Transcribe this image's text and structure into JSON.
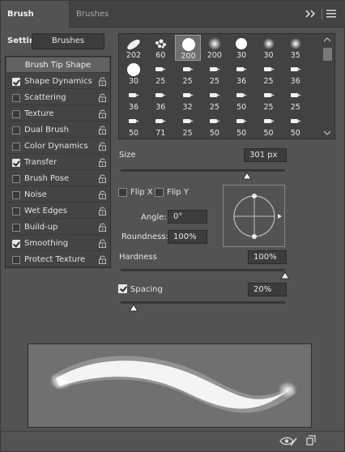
{
  "tabs": [
    {
      "label": "Brush Settings",
      "active": true
    },
    {
      "label": "Brushes",
      "active": false
    }
  ],
  "header_icons": {
    "collapse": "double-chevron-right-icon",
    "menu": "hamburger-menu-icon"
  },
  "brushes_button": {
    "label": "Brushes"
  },
  "options": {
    "brush_tip_shape": "Brush Tip Shape",
    "items": [
      {
        "label": "Shape Dynamics",
        "checked": true
      },
      {
        "label": "Scattering",
        "checked": false
      },
      {
        "label": "Texture",
        "checked": false
      },
      {
        "label": "Dual Brush",
        "checked": false
      },
      {
        "label": "Color Dynamics",
        "checked": false
      },
      {
        "label": "Transfer",
        "checked": true
      },
      {
        "label": "Brush Pose",
        "checked": false
      },
      {
        "label": "Noise",
        "checked": false
      },
      {
        "label": "Wet Edges",
        "checked": false
      },
      {
        "label": "Build-up",
        "checked": false
      },
      {
        "label": "Smoothing",
        "checked": true
      },
      {
        "label": "Protect Texture",
        "checked": false
      }
    ]
  },
  "brush_grid": {
    "selected_index": 2,
    "rows": [
      [
        "202",
        "60",
        "200",
        "200",
        "30",
        "30",
        "35"
      ],
      [
        "30",
        "25",
        "25",
        "25",
        "36",
        "25",
        "36"
      ],
      [
        "36",
        "36",
        "32",
        "25",
        "50",
        "25",
        "25"
      ],
      [
        "50",
        "71",
        "25",
        "50",
        "50",
        "50",
        "50"
      ]
    ]
  },
  "size": {
    "label": "Size",
    "value": "301 px",
    "level_fraction": 0.77
  },
  "flip": {
    "x_label": "Flip X",
    "x_checked": false,
    "y_label": "Flip Y",
    "y_checked": false
  },
  "angle": {
    "label": "Angle:",
    "value": "0°"
  },
  "roundness": {
    "label": "Roundness:",
    "value": "100%"
  },
  "hardness": {
    "label": "Hardness",
    "value": "100%",
    "level_fraction": 1.0
  },
  "spacing": {
    "label": "Spacing",
    "checked": true,
    "value": "20%",
    "level_fraction": 0.08
  },
  "footer_icons": {
    "toggle_preview": "eye-pencil-icon",
    "new_brush": "new-brush-preset-icon"
  },
  "colors": {
    "panel": "#535353",
    "field": "#3c3c3c",
    "list_bg": "#444444",
    "header_row": "#626262",
    "preview_bg": "#707070"
  }
}
